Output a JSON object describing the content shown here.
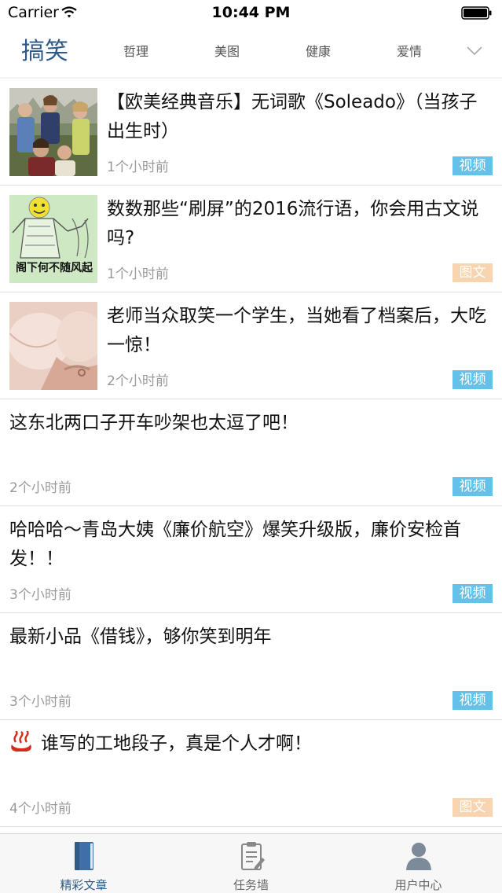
{
  "status_bar": {
    "carrier": "Carrier",
    "time": "10:44 PM"
  },
  "categories": {
    "active": "搞笑",
    "tabs": [
      "哲理",
      "美图",
      "健康",
      "爱情"
    ],
    "expand_icon": "chevron-down-icon"
  },
  "feed": [
    {
      "title": "【欧美经典音乐】无词歌《Soleado》（当孩子出生时）",
      "time": "1个小时前",
      "tag": "视频",
      "tag_type": "video",
      "thumbnail": "band-photo"
    },
    {
      "title": "数数那些“刷屏”的2016流行语，你会用古文说吗?",
      "time": "1个小时前",
      "tag": "图文",
      "tag_type": "photo",
      "thumbnail": "meme-image"
    },
    {
      "title": "老师当众取笑一个学生，当她看了档案后，大吃一惊！",
      "time": "2个小时前",
      "tag": "视频",
      "tag_type": "video",
      "thumbnail": "skin-photo"
    },
    {
      "title": "这东北两口子开车吵架也太逗了吧！",
      "time": "2个小时前",
      "tag": "视频",
      "tag_type": "video"
    },
    {
      "title": "哈哈哈～青岛大姨《廉价航空》爆笑升级版，廉价安检首发！！",
      "time": "3个小时前",
      "tag": "视频",
      "tag_type": "video"
    },
    {
      "title": "最新小品《借钱》，够你笑到明年",
      "time": "3个小时前",
      "tag": "视频",
      "tag_type": "video"
    },
    {
      "title": "谁写的工地段子，真是个人才啊！",
      "time": "4个小时前",
      "tag": "图文",
      "tag_type": "photo",
      "icon": "hot-springs-icon"
    }
  ],
  "meme_text": "阁下何不随风起",
  "tab_bar": [
    {
      "label": "精彩文章",
      "icon": "book-icon",
      "active": true
    },
    {
      "label": "任务墙",
      "icon": "clipboard-icon",
      "active": false
    },
    {
      "label": "用户中心",
      "icon": "user-icon",
      "active": false
    }
  ],
  "colors": {
    "accent": "#2f5a86",
    "video_tag": "#64c1ea",
    "photo_tag": "#f8d4b0"
  }
}
